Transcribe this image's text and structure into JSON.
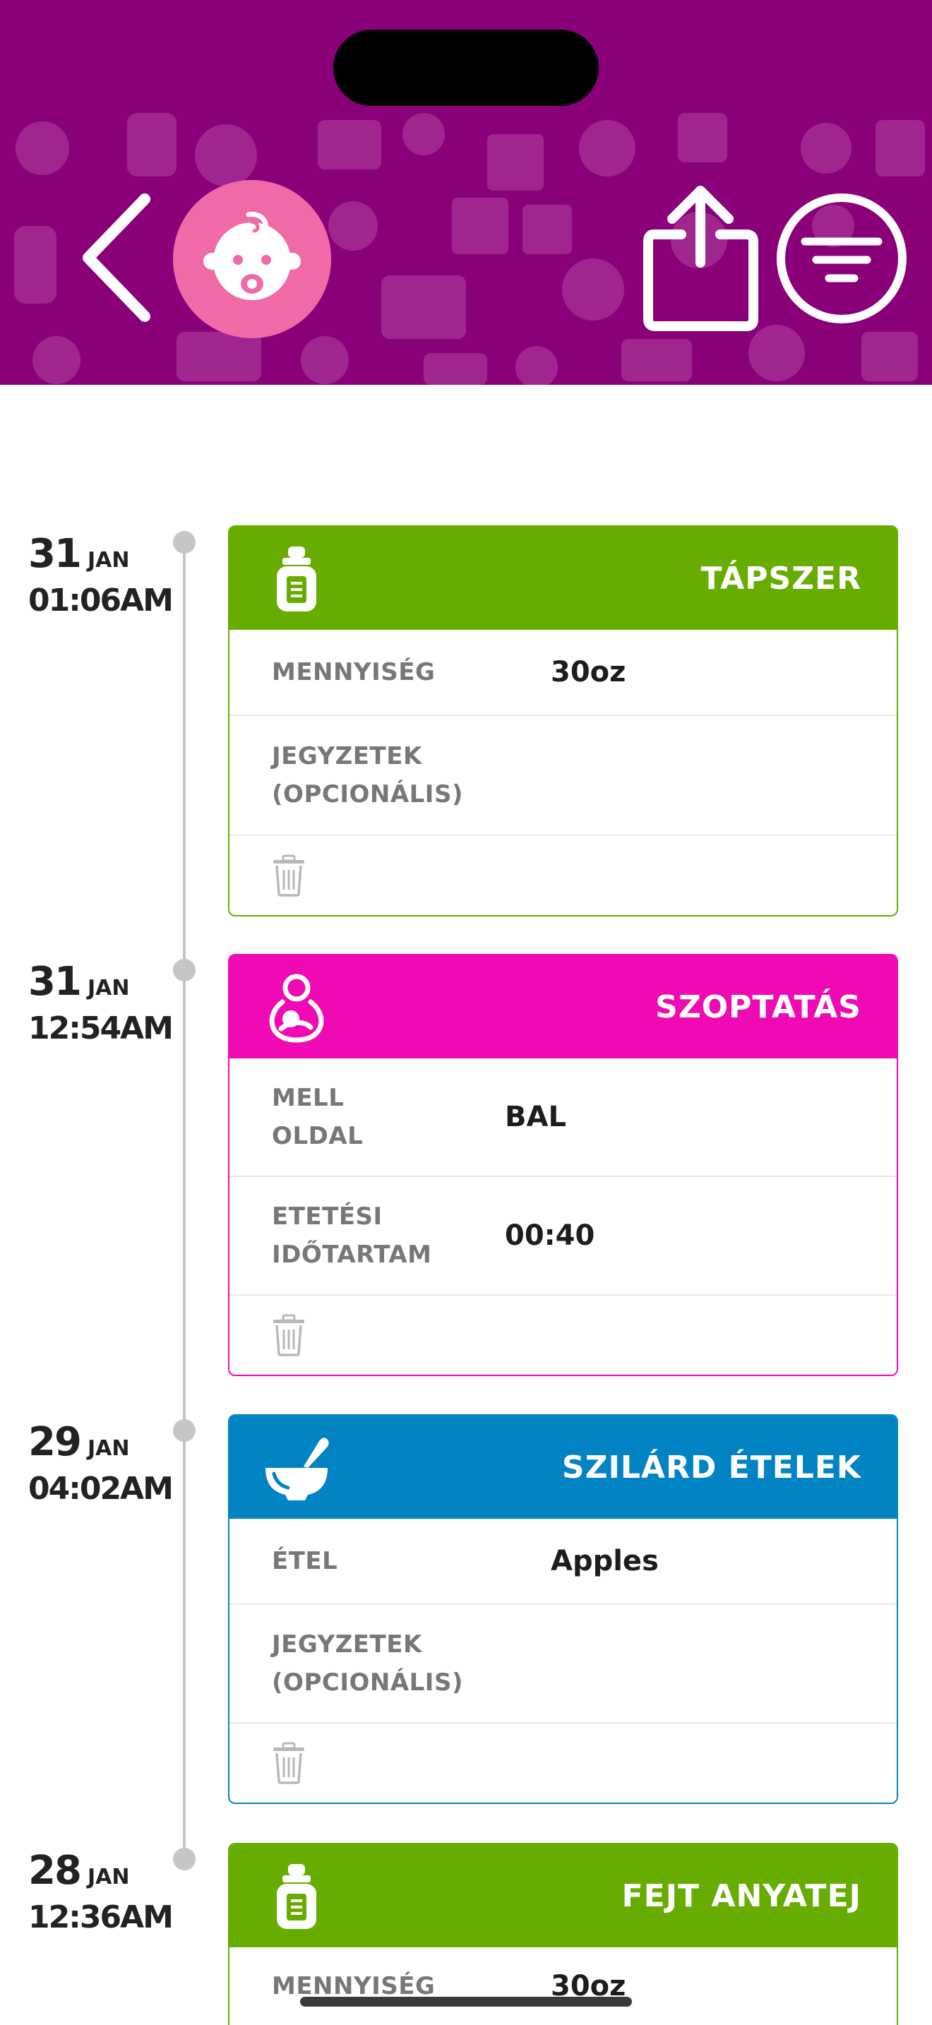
{
  "header": {
    "background_color": "#8a0079",
    "avatar_color": "#ef6aa7",
    "back_icon": "chevron-left-icon",
    "avatar_icon": "baby-face-icon",
    "share_icon": "share-icon",
    "filter_icon": "filter-icon"
  },
  "entries": [
    {
      "day": "31",
      "month": "JAN",
      "time": "01:06AM",
      "title": "TÁPSZER",
      "color": "#67ad00",
      "icon": "baby-bottle-icon",
      "rows": [
        {
          "label": "MENNYISÉG",
          "value": "30oz"
        },
        {
          "label_l1": "JEGYZETEK",
          "label_l2": "(OPCIONÁLIS)",
          "value": ""
        }
      ]
    },
    {
      "day": "31",
      "month": "JAN",
      "time": "12:54AM",
      "title": "SZOPTATÁS",
      "color": "#f00ab3",
      "icon": "breastfeeding-icon",
      "rows": [
        {
          "label_l1": "MELL",
          "label_l2": "OLDAL",
          "value": "BAL"
        },
        {
          "label_l1": "ETETÉSI",
          "label_l2": "IDŐTARTAM",
          "value": "00:40"
        }
      ]
    },
    {
      "day": "29",
      "month": "JAN",
      "time": "04:02AM",
      "title": "SZILÁRD ÉTELEK",
      "color": "#0283c4",
      "icon": "mortar-bowl-icon",
      "rows": [
        {
          "label": "ÉTEL",
          "value": "Apples"
        },
        {
          "label_l1": "JEGYZETEK",
          "label_l2": "(OPCIONÁLIS)",
          "value": ""
        }
      ]
    },
    {
      "day": "28",
      "month": "JAN",
      "time": "12:36AM",
      "title": "FEJT ANYATEJ",
      "color": "#67ad00",
      "icon": "baby-bottle-icon",
      "rows": [
        {
          "label": "MENNYISÉG",
          "value": "30oz"
        }
      ]
    }
  ]
}
